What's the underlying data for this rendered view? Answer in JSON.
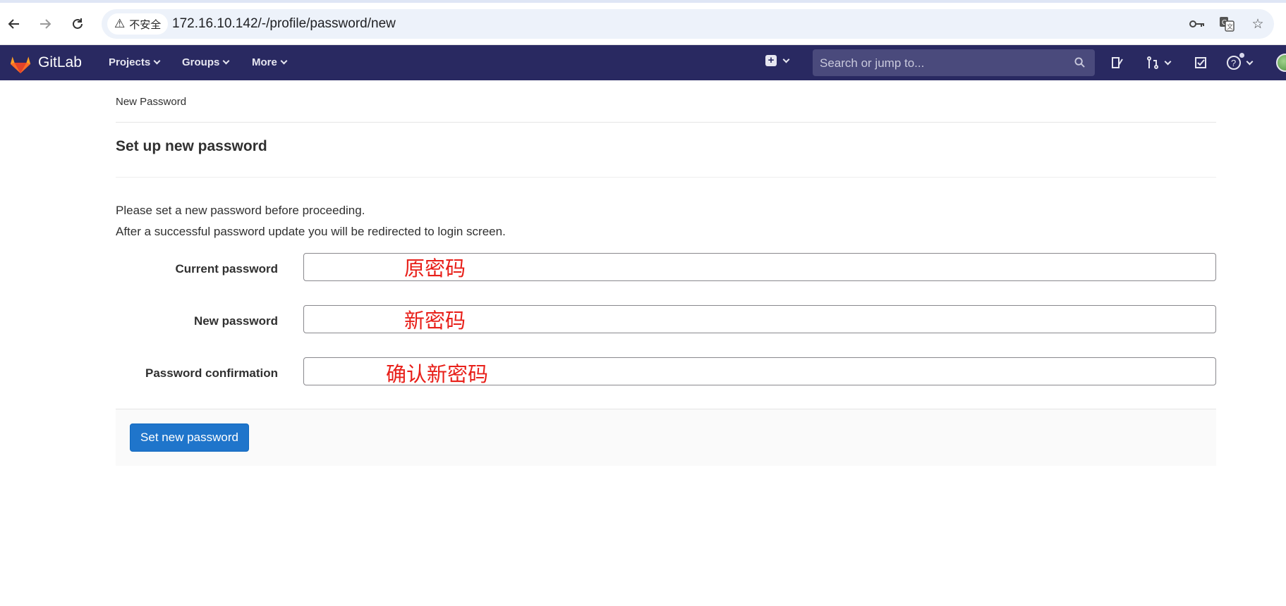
{
  "browser": {
    "security_label": "不安全",
    "url": "172.16.10.142/-/profile/password/new"
  },
  "header": {
    "brand": "GitLab",
    "nav": [
      "Projects",
      "Groups",
      "More"
    ],
    "search_placeholder": "Search or jump to...",
    "colors": {
      "bar": "#292961",
      "logo": "#e24329"
    }
  },
  "page": {
    "breadcrumb": "New Password",
    "title": "Set up new password",
    "intro_line1": "Please set a new password before proceeding.",
    "intro_line2": "After a successful password update you will be redirected to login screen."
  },
  "form": {
    "fields": [
      {
        "label": "Current password",
        "annotation": "原密码"
      },
      {
        "label": "New password",
        "annotation": "新密码"
      },
      {
        "label": "Password confirmation",
        "annotation": "确认新密码"
      }
    ],
    "submit_label": "Set new password",
    "colors": {
      "submit": "#1f75cb",
      "annotation": "#e8201a"
    }
  }
}
